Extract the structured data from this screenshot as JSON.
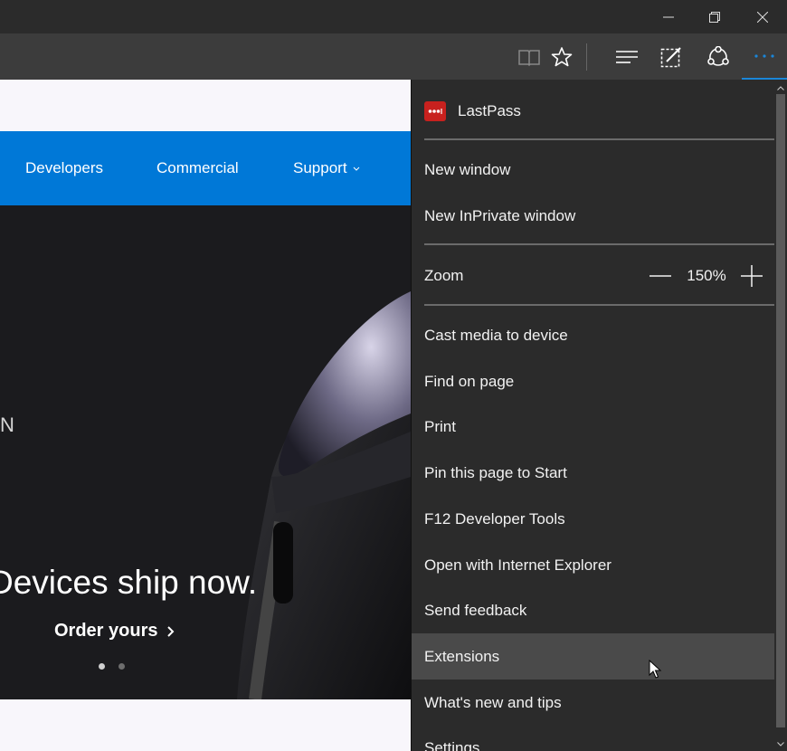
{
  "window_controls": {
    "minimize_icon": "minimize-icon",
    "restore_icon": "restore-icon",
    "close_icon": "close-icon"
  },
  "toolbar": {
    "icons": [
      "reading-view-icon",
      "favorite-star-icon",
      "hub-icon",
      "web-note-icon",
      "share-icon",
      "more-actions-icon"
    ],
    "accent": "#1a86d9"
  },
  "page": {
    "nav": {
      "items": [
        {
          "label": "Developers"
        },
        {
          "label": "Commercial"
        },
        {
          "label": "Support"
        }
      ],
      "color": "#0078d7"
    },
    "hero": {
      "partial_text": "N",
      "headline": "Devices ship now.",
      "cta": "Order yours",
      "carousel_dots": 2,
      "active_dot": 1
    }
  },
  "menu": {
    "extension": {
      "label": "LastPass",
      "icon": "lastpass-icon"
    },
    "items_group1": [
      {
        "label": "New window"
      },
      {
        "label": "New InPrivate window"
      }
    ],
    "zoom": {
      "label": "Zoom",
      "value": "150%"
    },
    "items_group2": [
      {
        "label": "Cast media to device"
      },
      {
        "label": "Find on page"
      },
      {
        "label": "Print"
      },
      {
        "label": "Pin this page to Start"
      },
      {
        "label": "F12 Developer Tools"
      },
      {
        "label": "Open with Internet Explorer"
      },
      {
        "label": "Send feedback"
      },
      {
        "label": "Extensions",
        "hovered": true
      },
      {
        "label": "What's new and tips"
      },
      {
        "label": "Settings"
      }
    ]
  }
}
